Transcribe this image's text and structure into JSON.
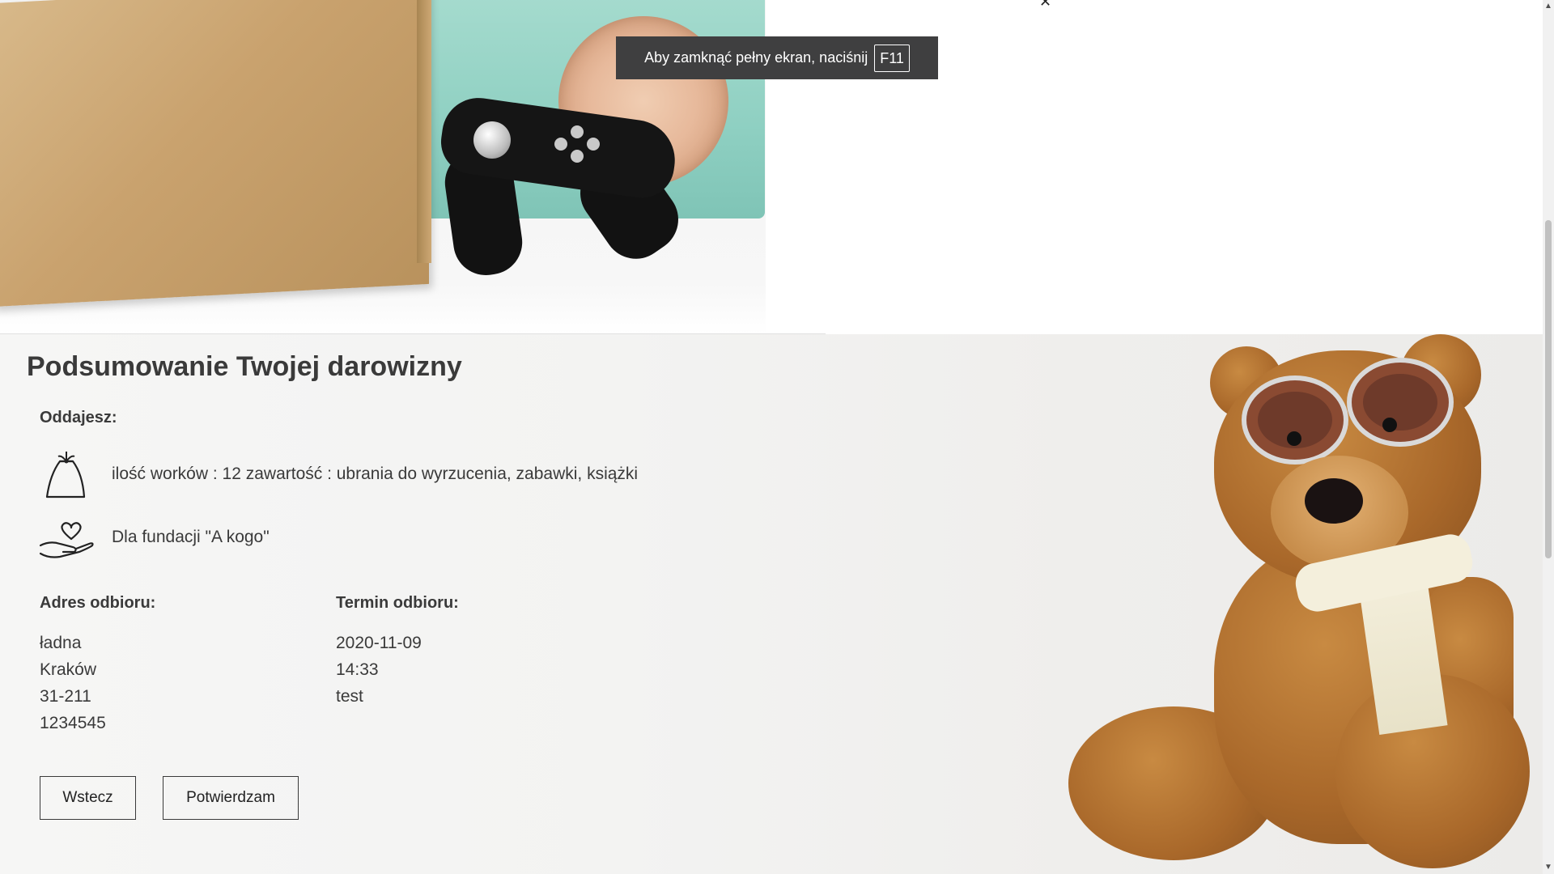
{
  "toast": {
    "text": "Aby zamknąć pełny ekran, naciśnij",
    "key": "F11"
  },
  "summary": {
    "title": "Podsumowanie Twojej darowizny",
    "giving_label": "Oddajesz:",
    "items_line": "ilość worków : 12 zawartość : ubrania do wyrzucenia, zabawki, książki",
    "foundation_line": "Dla fundacji \"A kogo\"",
    "address": {
      "label": "Adres odbioru:",
      "lines": [
        "ładna",
        "Kraków",
        "31-211",
        "1234545"
      ]
    },
    "pickup": {
      "label": "Termin odbioru:",
      "lines": [
        "2020-11-09",
        "14:33",
        "test"
      ]
    },
    "buttons": {
      "back": "Wstecz",
      "confirm": "Potwierdzam"
    }
  },
  "icons": {
    "bag": "bag-icon",
    "heart_hand": "heart-hand-icon"
  }
}
